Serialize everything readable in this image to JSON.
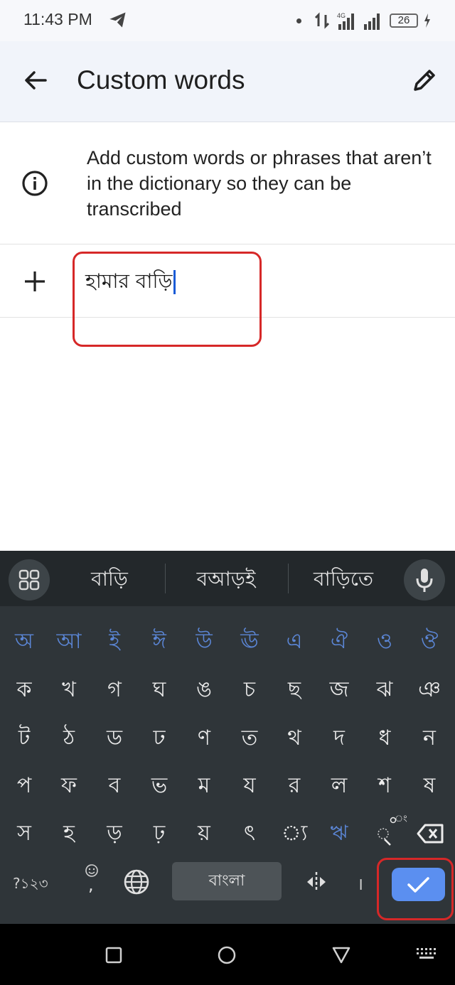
{
  "status_bar": {
    "time": "11:43 PM",
    "battery": "26"
  },
  "app_bar": {
    "title": "Custom words"
  },
  "info": {
    "text": "Add custom words or phrases that aren’t in the dictionary so they can be transcribed"
  },
  "add_row": {
    "input_value": "হামার বাড়ি"
  },
  "keyboard": {
    "suggestions": [
      "বাড়ি",
      "বআড়ই",
      "বাড়িতে"
    ],
    "vowel_row": [
      "অ",
      "আ",
      "ই",
      "ঈ",
      "উ",
      "ঊ",
      "এ",
      "ঐ",
      "ও",
      "ঔ"
    ],
    "row1": [
      "ক",
      "খ",
      "গ",
      "ঘ",
      "ঙ",
      "চ",
      "ছ",
      "জ",
      "ঝ",
      "ঞ"
    ],
    "row2": [
      "ট",
      "ঠ",
      "ড",
      "ঢ",
      "ণ",
      "ত",
      "থ",
      "দ",
      "ধ",
      "ন"
    ],
    "row3": [
      "প",
      "ফ",
      "ব",
      "ভ",
      "ম",
      "য",
      "র",
      "ল",
      "শ",
      "ষ"
    ],
    "row4": [
      "স",
      "হ",
      "ড়",
      "ঢ়",
      "য়",
      "ৎ",
      "্য",
      "ঋ",
      "ং"
    ],
    "symbols_label": "?১২৩",
    "comma_label": ",",
    "space_label": "বাংলা",
    "danda_label": "।",
    "hasant_superscript": "ং"
  },
  "colors": {
    "accent": "#5b8ff0",
    "highlight": "#d62828",
    "keyboard_bg": "#2f3539"
  }
}
